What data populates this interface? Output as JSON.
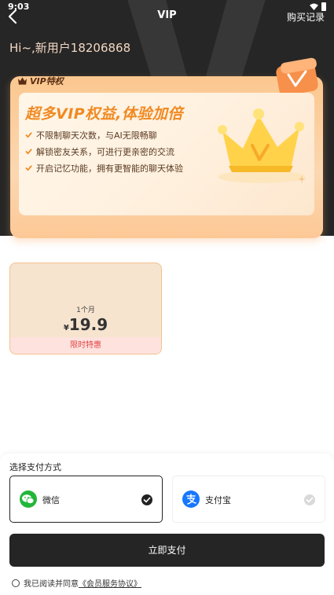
{
  "status_bar": {
    "time": "9:03"
  },
  "nav": {
    "title": "VIP",
    "right_action": "购买记录"
  },
  "greeting": "Hi~,新用户18206868",
  "vip_card": {
    "badge": "VIP特权",
    "headline": "超多VIP权益,体验加倍",
    "benefits": [
      "不限制聊天次数，与AI无限畅聊",
      "解锁密友关系，可进行更亲密的交流",
      "开启记忆功能，拥有更智能的聊天体验"
    ]
  },
  "plan": {
    "duration": "1个月",
    "currency": "¥",
    "price": "19.9",
    "tag": "限时特惠"
  },
  "payment": {
    "title": "选择支付方式",
    "options": [
      {
        "label": "微信",
        "selected": true
      },
      {
        "label": "支付宝",
        "selected": false
      }
    ],
    "pay_button": "立即支付",
    "agree_text": "我已阅读并同意",
    "agree_link": "《会员服务协议》"
  },
  "colors": {
    "hero_bg": "#262626",
    "accent_orange": "#f08a23",
    "pay_button_bg": "#252525",
    "tag_red": "#e2474a",
    "wechat_green": "#22b63a",
    "alipay_blue": "#1677ff"
  }
}
